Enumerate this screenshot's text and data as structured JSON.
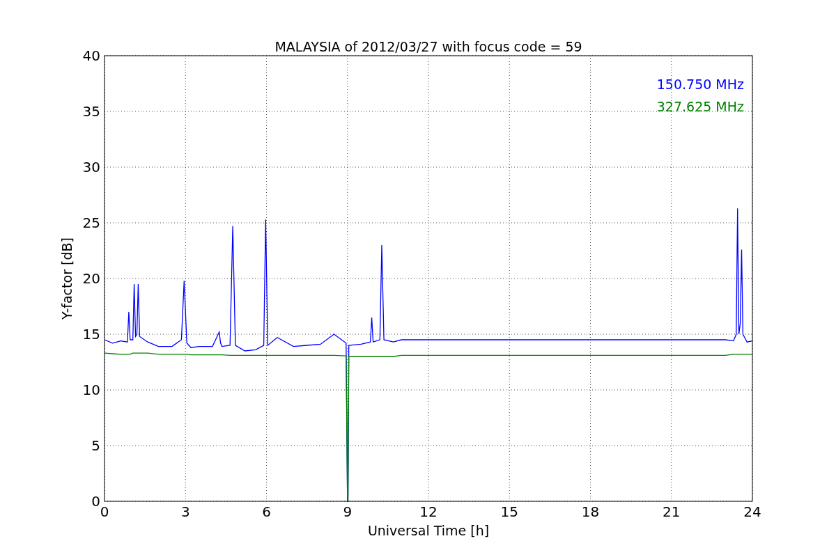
{
  "chart_data": {
    "type": "line",
    "title": "MALAYSIA of 2012/03/27 with focus code = 59",
    "xlabel": "Universal Time [h]",
    "ylabel": "Y-factor [dB]",
    "x": [
      0,
      0.3,
      0.6,
      0.85,
      0.9,
      0.95,
      1.05,
      1.1,
      1.15,
      1.2,
      1.25,
      1.3,
      1.6,
      2.0,
      2.5,
      2.85,
      2.95,
      3.05,
      3.2,
      3.5,
      4.0,
      4.25,
      4.3,
      4.35,
      4.65,
      4.75,
      4.85,
      5.2,
      5.6,
      5.9,
      5.97,
      6.05,
      6.4,
      7.0,
      7.5,
      8.0,
      8.5,
      8.95,
      9.0,
      9.02,
      9.05,
      9.5,
      9.85,
      9.9,
      9.95,
      10.2,
      10.27,
      10.35,
      10.7,
      11.0,
      23.0,
      23.3,
      23.4,
      23.45,
      23.5,
      23.55,
      23.6,
      23.65,
      23.8,
      24.0
    ],
    "series": [
      {
        "name": "150.750 MHz",
        "color": "#0000ff",
        "values": [
          14.5,
          14.2,
          14.4,
          14.3,
          17,
          14.5,
          14.5,
          19.5,
          14.8,
          15,
          19.5,
          14.8,
          14.3,
          13.9,
          13.9,
          14.5,
          19.8,
          14.2,
          13.8,
          13.9,
          13.9,
          15.2,
          14.2,
          13.9,
          14.0,
          24.7,
          14.0,
          13.5,
          13.6,
          14.0,
          25.3,
          14.0,
          14.7,
          13.9,
          14.0,
          14.1,
          15.0,
          14.2,
          0,
          0,
          14.0,
          14.1,
          14.3,
          16.5,
          14.3,
          14.5,
          23.0,
          14.5,
          14.3,
          14.5,
          14.5,
          14.4,
          15,
          26.3,
          15,
          16,
          22.6,
          15,
          14.3,
          14.4
        ]
      },
      {
        "name": "327.625 MHz",
        "color": "#008000",
        "values": [
          13.3,
          13.25,
          13.2,
          13.2,
          13.2,
          13.2,
          13.3,
          13.3,
          13.3,
          13.3,
          13.3,
          13.3,
          13.3,
          13.2,
          13.2,
          13.2,
          13.2,
          13.2,
          13.15,
          13.15,
          13.15,
          13.15,
          13.15,
          13.15,
          13.1,
          13.1,
          13.1,
          13.1,
          13.1,
          13.1,
          13.1,
          13.1,
          13.1,
          13.1,
          13.1,
          13.1,
          13.1,
          13.05,
          0,
          0,
          13.0,
          13.0,
          13.0,
          13.0,
          13.0,
          13.0,
          13.0,
          13.0,
          13.0,
          13.1,
          13.1,
          13.2,
          13.2,
          13.2,
          13.2,
          13.2,
          13.2,
          13.2,
          13.2,
          13.2
        ]
      }
    ],
    "xlim": [
      0,
      24
    ],
    "ylim": [
      0,
      40
    ],
    "xticks": [
      0,
      3,
      6,
      9,
      12,
      15,
      18,
      21,
      24
    ],
    "yticks": [
      0,
      5,
      10,
      15,
      20,
      25,
      30,
      35,
      40
    ],
    "grid": true
  }
}
